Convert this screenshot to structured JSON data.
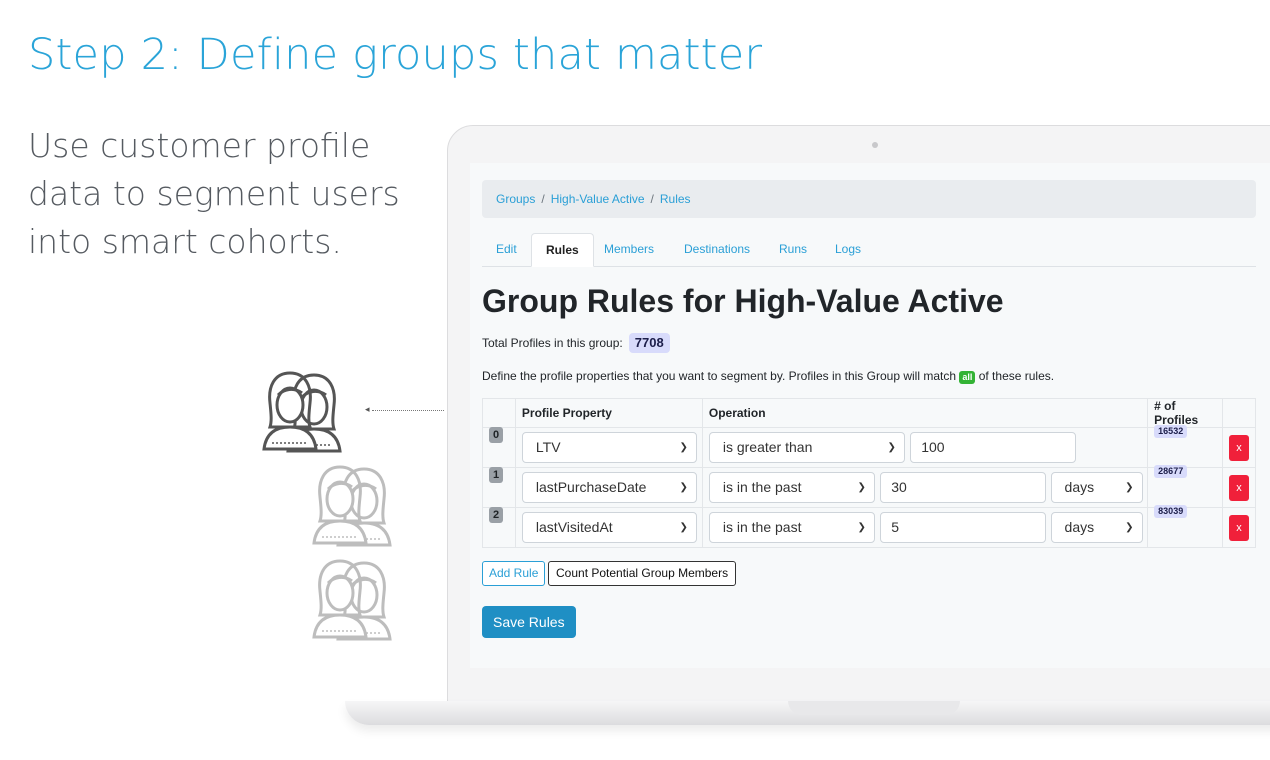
{
  "hero": {
    "headline": "Step 2: Define groups that matter",
    "subtext": "Use customer profile data to segment users into smart cohorts."
  },
  "breadcrumb": [
    "Groups",
    "High-Value Active",
    "Rules"
  ],
  "tabs": [
    {
      "label": "Edit",
      "active": false
    },
    {
      "label": "Rules",
      "active": true
    },
    {
      "label": "Members",
      "active": false
    },
    {
      "label": "Destinations",
      "active": false
    },
    {
      "label": "Runs",
      "active": false
    },
    {
      "label": "Logs",
      "active": false
    }
  ],
  "page": {
    "title": "Group Rules for High-Value Active",
    "total_label": "Total Profiles in this group:",
    "total_count": "7708",
    "define_prefix": "Define the profile properties that you want to segment by. Profiles in this Group will match",
    "match_mode": "all",
    "define_suffix": "of these rules."
  },
  "table": {
    "headers": {
      "property": "Profile Property",
      "operation": "Operation",
      "profiles": "# of Profiles"
    },
    "rows": [
      {
        "index": "0",
        "property": "LTV",
        "operation": "is greater than",
        "value": "100",
        "unit": "",
        "profiles": "16532",
        "remove": "x"
      },
      {
        "index": "1",
        "property": "lastPurchaseDate",
        "operation": "is in the past",
        "value": "30",
        "unit": "days",
        "profiles": "28677",
        "remove": "x"
      },
      {
        "index": "2",
        "property": "lastVisitedAt",
        "operation": "is in the past",
        "value": "5",
        "unit": "days",
        "profiles": "83039",
        "remove": "x"
      }
    ]
  },
  "buttons": {
    "add_rule": "Add Rule",
    "count_members": "Count Potential Group Members",
    "save_rules": "Save Rules"
  },
  "colors": {
    "accent": "#2aa4d8",
    "primary": "#1f8fc4",
    "danger": "#f0203a",
    "success": "#33b335",
    "badge": "#d8dbfb"
  }
}
